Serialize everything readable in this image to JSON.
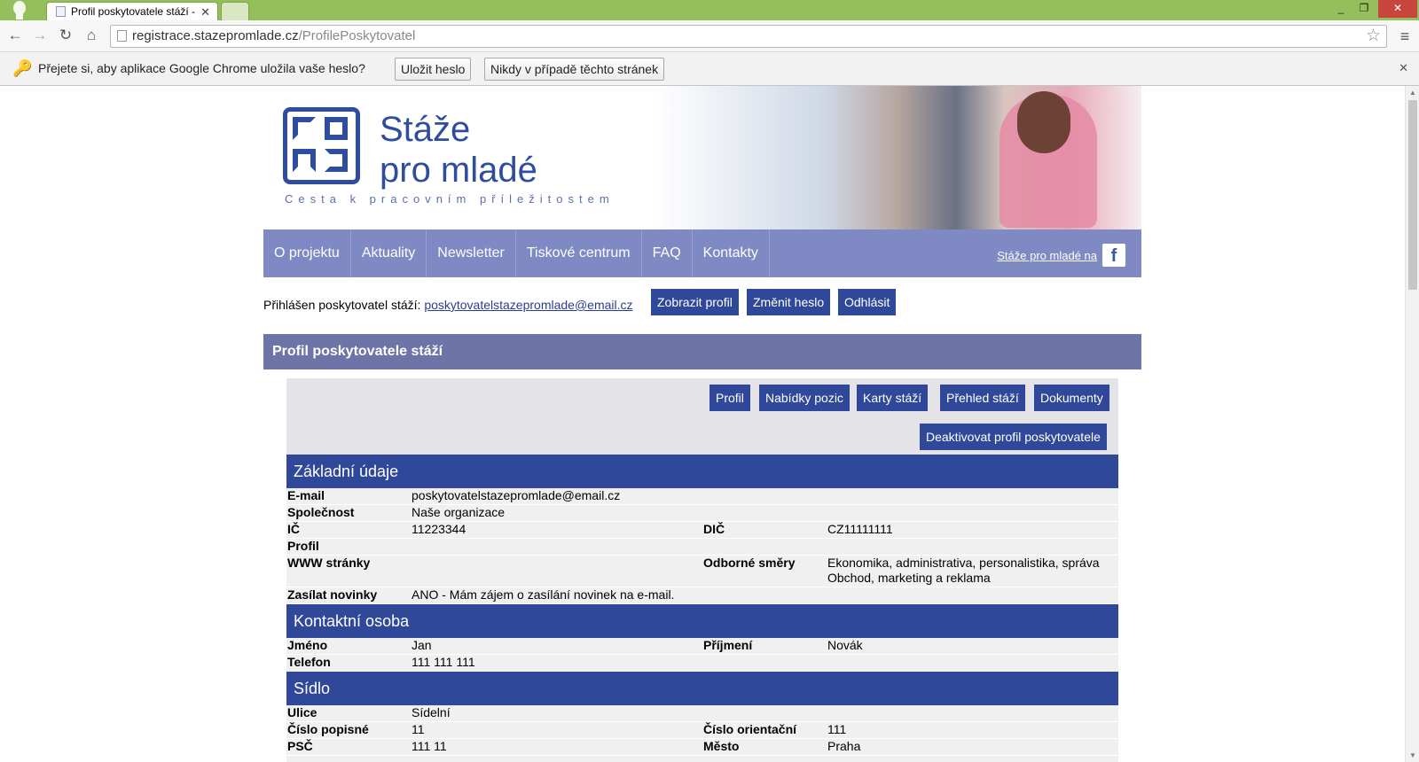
{
  "browser": {
    "tab_title": "Profil poskytovatele stáží -",
    "url_host": "registrace.stazepromlade.cz",
    "url_path": "/ProfilePoskytovatel",
    "infobar": {
      "text": "Přejete si, aby aplikace Google Chrome uložila vaše heslo?",
      "save_label": "Uložit heslo",
      "never_label": "Nikdy v případě těchto stránek"
    }
  },
  "site": {
    "logo_line1": "Stáže",
    "logo_line2": "pro mladé",
    "tagline": "Cesta k pracovním příležitostem",
    "nav": [
      "O projektu",
      "Aktuality",
      "Newsletter",
      "Tiskové centrum",
      "FAQ",
      "Kontakty"
    ],
    "facebook_text": "Stáže pro mladé na",
    "login_prefix": "Přihlášen poskytovatel stáží:",
    "login_email": "poskytovatelstazepromlade@email.cz",
    "btn_show_profile": "Zobrazit profil",
    "btn_change_password": "Změnit heslo",
    "btn_logout": "Odhlásit",
    "section_title": "Profil poskytovatele stáží",
    "tabs": [
      "Profil",
      "Nabídky pozic",
      "Karty stáží",
      "Přehled stáží",
      "Dokumenty"
    ],
    "btn_deactivate": "Deaktivovat profil poskytovatele"
  },
  "profile": {
    "basic_title": "Základní údaje",
    "email_k": "E-mail",
    "email_v": "poskytovatelstazepromlade@email.cz",
    "company_k": "Společnost",
    "company_v": "Naše organizace",
    "ic_k": "IČ",
    "ic_v": "11223344",
    "dic_k": "DIČ",
    "dic_v": "CZ11111111",
    "profil_k": "Profil",
    "www_k": "WWW stránky",
    "fields_k": "Odborné směry",
    "fields_v1": "Ekonomika, administrativa, personalistika, správa",
    "fields_v2": "Obchod, marketing a reklama",
    "news_k": "Zasílat novinky",
    "news_v": "ANO - Mám zájem o zasílání novinek na e-mail.",
    "contact_title": "Kontaktní osoba",
    "name_k": "Jméno",
    "name_v": "Jan",
    "surname_k": "Příjmení",
    "surname_v": "Novák",
    "phone_k": "Telefon",
    "phone_v": "111 111 111",
    "seat_title": "Sídlo",
    "street_k": "Ulice",
    "street_v": "Sídelní",
    "cp_k": "Číslo popisné",
    "cp_v": "11",
    "co_k": "Číslo orientační",
    "co_v": "111",
    "psc_k": "PSČ",
    "psc_v": "111 11",
    "city_k": "Město",
    "city_v": "Praha"
  },
  "colors": {
    "nav": "#7f89c4",
    "brand_blue": "#2f4899",
    "section": "#6d75a8",
    "chrome_frame": "#94bf5b"
  }
}
